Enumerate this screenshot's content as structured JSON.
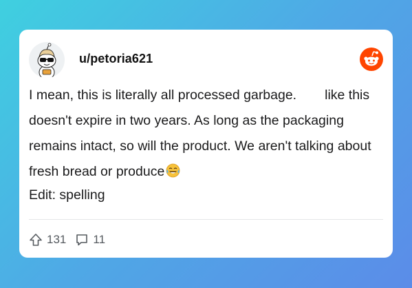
{
  "post": {
    "username": "u/petoria621",
    "body_line1_a": "I mean, this is literally all processed garbage.",
    "body_line1_b": "like",
    "body_rest": "this doesn't expire in two years. As long as the packaging remains intact, so will the product. We aren't talking about fresh bread or produce",
    "edit_text": "Edit: spelling"
  },
  "stats": {
    "upvotes": "131",
    "comments": "11"
  },
  "icons": {
    "avatar": "snoo-avatar-sunglasses",
    "brand": "reddit-logo-icon",
    "emoji": "face-with-tears-of-joy",
    "upvote": "upvote-arrow-icon",
    "comment": "comment-bubble-icon"
  },
  "colors": {
    "background_start": "#3fd0e0",
    "background_end": "#5b8ce8",
    "reddit_orange": "#ff4500",
    "text": "#1a1a1b",
    "muted": "#555a5f"
  }
}
